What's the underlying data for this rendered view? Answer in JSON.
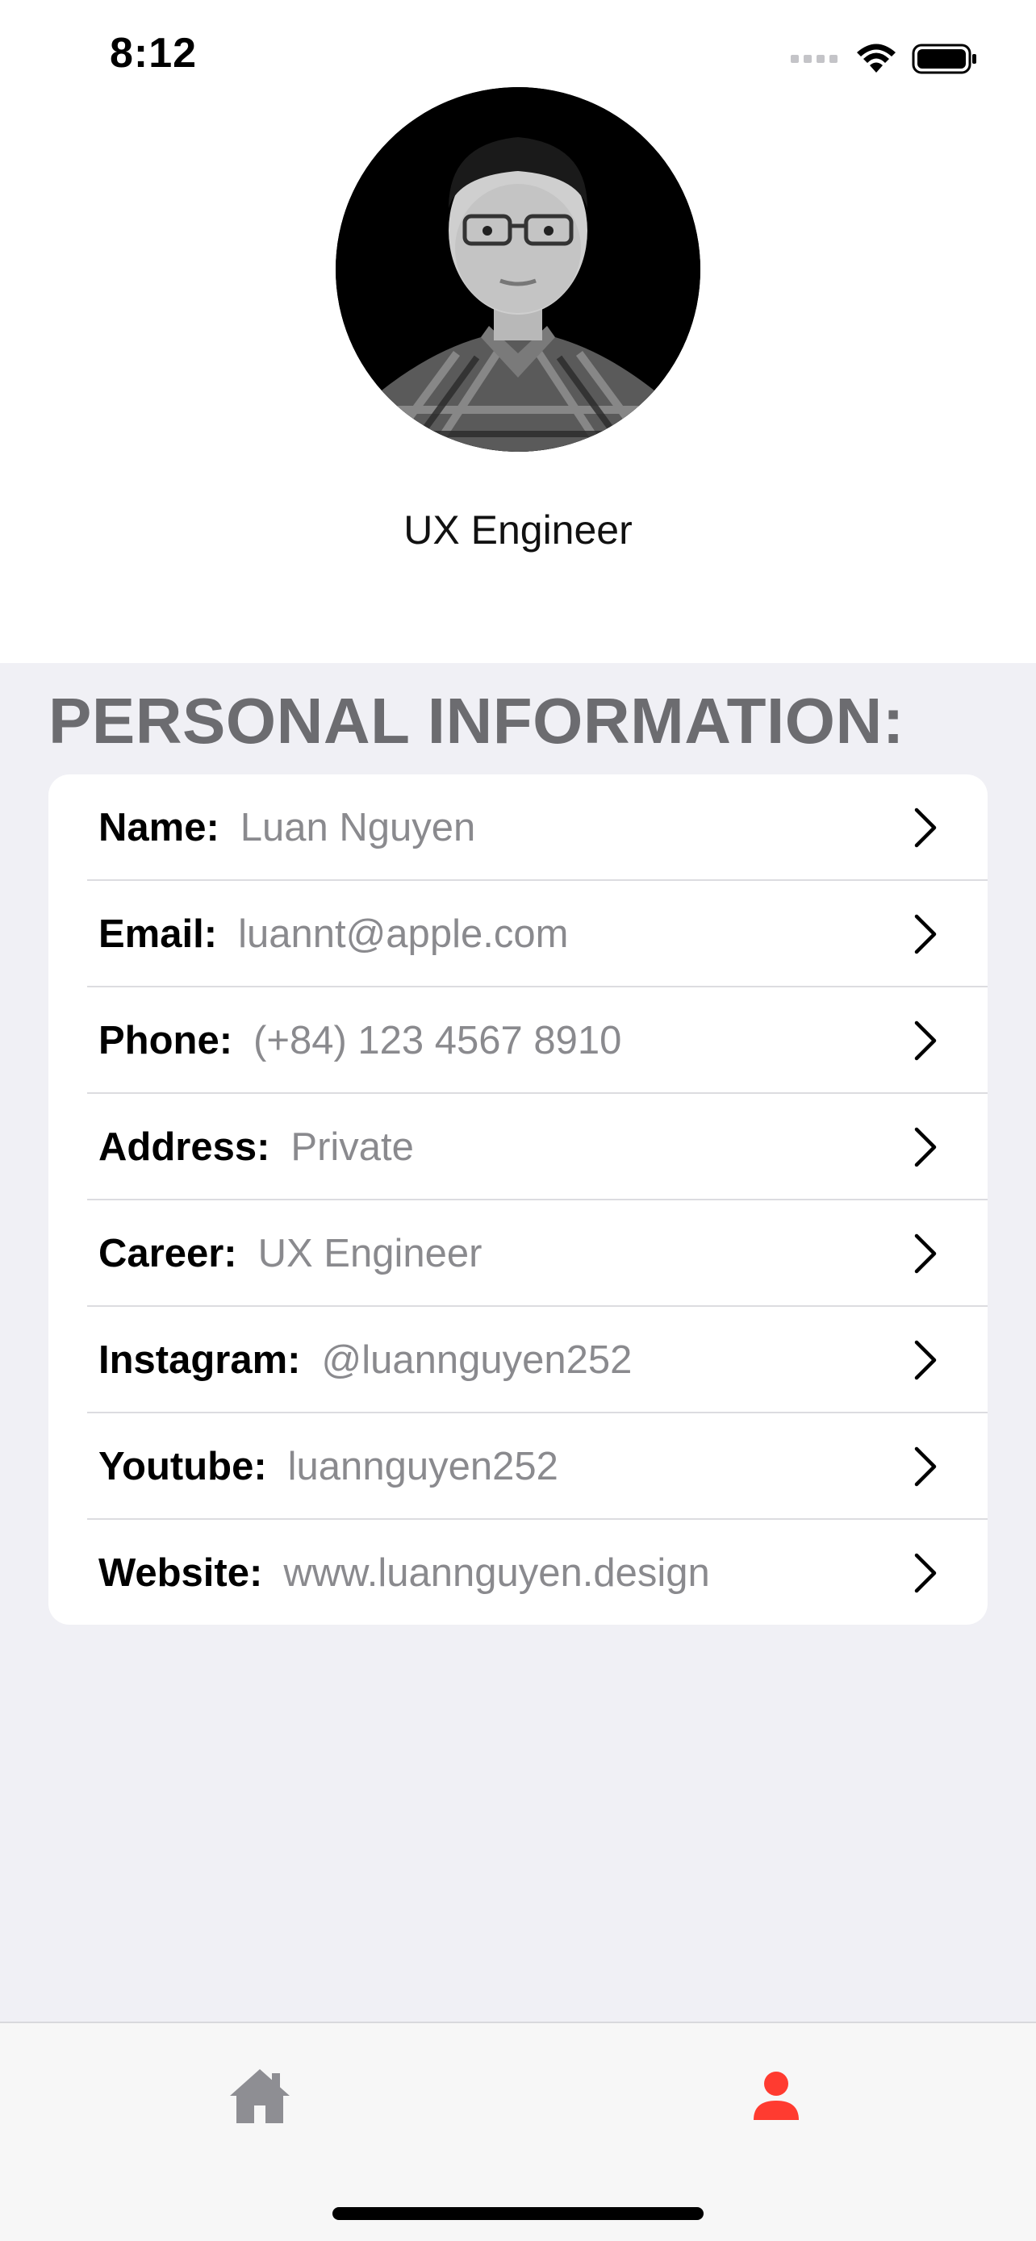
{
  "status_bar": {
    "time": "8:12"
  },
  "profile": {
    "subtitle": "UX Engineer"
  },
  "section": {
    "title": "PERSONAL INFORMATION:"
  },
  "info_rows": [
    {
      "label": "Name:",
      "value": "Luan Nguyen"
    },
    {
      "label": "Email:",
      "value": "luannt@apple.com"
    },
    {
      "label": "Phone:",
      "value": "(+84) 123 4567 8910"
    },
    {
      "label": "Address:",
      "value": "Private"
    },
    {
      "label": "Career:",
      "value": "UX Engineer"
    },
    {
      "label": "Instagram:",
      "value": "@luannguyen252"
    },
    {
      "label": "Youtube:",
      "value": "luannguyen252"
    },
    {
      "label": "Website:",
      "value": "www.luannguyen.design"
    }
  ],
  "tab_bar": {
    "tabs": [
      {
        "icon": "house-icon",
        "selected": false,
        "color": "#8e8e93"
      },
      {
        "icon": "person-icon",
        "selected": true,
        "color": "#ff3b30"
      }
    ]
  },
  "colors": {
    "accent": "#ff3b30",
    "grouped_background": "#f0f0f5",
    "secondary_text": "#8a8a8e",
    "section_title": "#6c6c70"
  }
}
